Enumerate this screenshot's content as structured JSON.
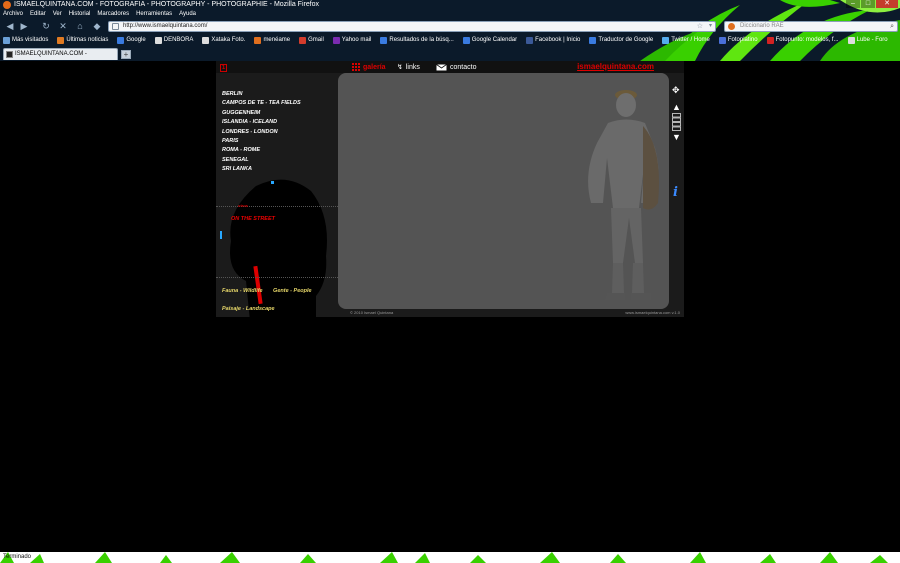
{
  "browser": {
    "title": "ISMAELQUINTANA.COM - FOTOGRAFIA - PHOTOGRAPHY - PHOTOGRAPHIE - Mozilla Firefox",
    "menu": [
      "Archivo",
      "Editar",
      "Ver",
      "Historial",
      "Marcadores",
      "Herramientas",
      "Ayuda"
    ],
    "url": "http://www.ismaelquintana.com/",
    "search_placeholder": "Diccionario RAE",
    "bookmarks": [
      {
        "label": "Más visitados",
        "color": "#6aa0d8"
      },
      {
        "label": "Últimas noticias",
        "color": "#e07a22"
      },
      {
        "label": "Google",
        "color": "#3a7be0"
      },
      {
        "label": "DENBORA",
        "color": "#dddddd"
      },
      {
        "label": "Xataka Foto.",
        "color": "#dddddd"
      },
      {
        "label": "menéame",
        "color": "#e06f1e"
      },
      {
        "label": "Gmail",
        "color": "#d43c2c"
      },
      {
        "label": "Yahoo mail",
        "color": "#7b2bb0"
      },
      {
        "label": "Resultados de la búsq...",
        "color": "#3a7be0"
      },
      {
        "label": "Google Calendar",
        "color": "#3a7be0"
      },
      {
        "label": "Facebook | Inicio",
        "color": "#3b5998"
      },
      {
        "label": "Traductor de Google",
        "color": "#3a7be0"
      },
      {
        "label": "Twitter / Home",
        "color": "#55acee"
      },
      {
        "label": "Fotoplatino",
        "color": "#4a6fd8"
      },
      {
        "label": "Fotopunto: modelos, f...",
        "color": "#d42222"
      },
      {
        "label": "Lube - Foro",
        "color": "#dddddd"
      }
    ],
    "tab_title": "ISMAELQUINTANA.COM - FOTOGRA...",
    "status": "Terminado"
  },
  "site": {
    "lang_label": "1",
    "nav": {
      "galeria": "galería",
      "links": "links",
      "contacto": "contacto"
    },
    "brand": "ismaelquintana.com",
    "cities": [
      "BERLIN",
      "CAMPOS DE TE - TEA FIELDS",
      "GUGGENHEIM",
      "ISLANDIA - ICELAND",
      "LONDRES - LONDON",
      "PARIS",
      "ROMA - ROME",
      "SENEGAL",
      "SRI LANKA"
    ],
    "others_label": "otros",
    "on_the_street": "ON THE STREET",
    "categories": {
      "fauna": "Fauna - Wildlife",
      "gente": "Gente - People",
      "paisaje": "Paisaje - Landscape"
    },
    "footer_left": "© 2010 Ismael Quintana",
    "footer_right": "www.ismaelquintana.com v.1.0"
  },
  "colors": {
    "grass": "#39d000",
    "accent_red": "#dd0000",
    "category_yellow": "#e8d86a"
  },
  "icons": [
    "firefox-icon",
    "back-icon",
    "forward-icon",
    "reload-icon",
    "stop-icon",
    "home-icon",
    "bookmark-star-icon",
    "search-icon",
    "move-icon",
    "arrow-up-icon",
    "arrow-down-icon",
    "info-icon",
    "grid-icon",
    "links-icon",
    "mail-icon"
  ]
}
